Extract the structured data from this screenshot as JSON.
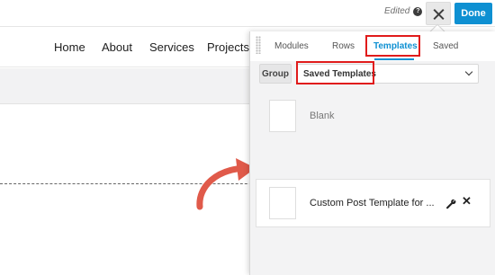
{
  "topbar": {
    "edited_label": "Edited",
    "help_icon_glyph": "?",
    "done_label": "Done"
  },
  "site_nav": {
    "items": [
      "Home",
      "About",
      "Services",
      "Projects"
    ]
  },
  "panel": {
    "tabs": [
      {
        "label": "Modules"
      },
      {
        "label": "Rows"
      },
      {
        "label": "Templates",
        "active": true
      },
      {
        "label": "Saved"
      }
    ],
    "group_label": "Group",
    "select_value": "Saved Templates",
    "templates": [
      {
        "label": "Blank"
      },
      {
        "label": "Custom Post Template for ..."
      }
    ]
  },
  "colors": {
    "accent": "#0e90d2",
    "highlight": "#e01b1b",
    "arrow": "#e05a4a"
  },
  "icons": {
    "help": "question-circle-icon",
    "close": "close-icon",
    "dropdown": "chevron-down-icon",
    "edit": "wrench-icon",
    "delete": "x-icon",
    "drag": "drag-handle-icon"
  }
}
